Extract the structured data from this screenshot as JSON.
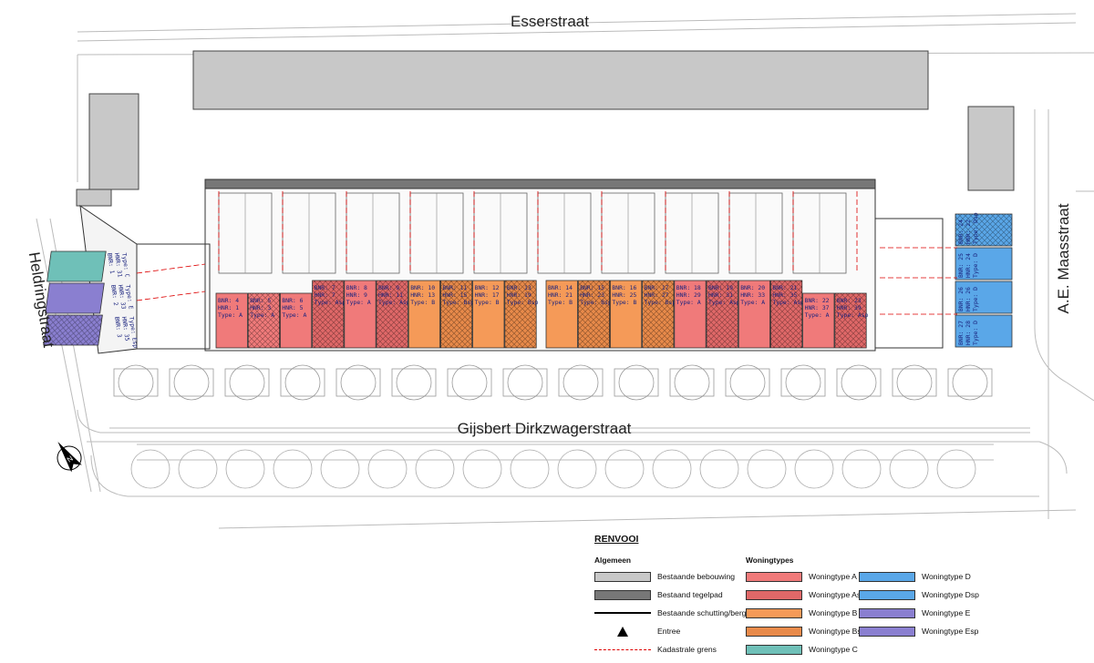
{
  "streets": {
    "north": "Esserstraat",
    "west": "Heldringstraat",
    "east": "A.E. Maasstraat",
    "south": "Gijsbert Dirkzwagerstraat"
  },
  "compass": {
    "label": "N"
  },
  "units_main": [
    {
      "bnr": "BNR: 4",
      "hnr": "HNR: 1",
      "type": "Type: A",
      "color": "#f07a7a",
      "hatch": false
    },
    {
      "bnr": "BNR: 5",
      "hnr": "HNR: 3",
      "type": "Type: A",
      "color": "#f07a7a",
      "hatch": true
    },
    {
      "bnr": "BNR: 6",
      "hnr": "HNR: 5",
      "type": "Type: A",
      "color": "#f07a7a",
      "hatch": false
    },
    {
      "bnr": "BNR: 7",
      "hnr": "HNR: 7",
      "type": "Type: Asp",
      "color": "#e06868",
      "hatch": true
    },
    {
      "bnr": "BNR: 8",
      "hnr": "HNR: 9",
      "type": "Type: A",
      "color": "#f07a7a",
      "hatch": false
    },
    {
      "bnr": "BNR: 9",
      "hnr": "HNR: 11",
      "type": "Type: Asp",
      "color": "#e06868",
      "hatch": true
    },
    {
      "bnr": "BNR: 10",
      "hnr": "HNR: 13",
      "type": "Type: B",
      "color": "#f59a58",
      "hatch": false
    },
    {
      "bnr": "BNR: 11",
      "hnr": "HNR: 15",
      "type": "Type: Bsp",
      "color": "#e88a4a",
      "hatch": true
    },
    {
      "bnr": "BNR: 12",
      "hnr": "HNR: 17",
      "type": "Type: B",
      "color": "#f59a58",
      "hatch": false
    },
    {
      "bnr": "BNR: 13",
      "hnr": "HNR: 19",
      "type": "Type: Bsp",
      "color": "#e88a4a",
      "hatch": true
    },
    {
      "bnr": "BNR: 14",
      "hnr": "HNR: 21",
      "type": "Type: B",
      "color": "#f59a58",
      "hatch": false
    },
    {
      "bnr": "BNR: 15",
      "hnr": "HNR: 23",
      "type": "Type: Bsp",
      "color": "#e88a4a",
      "hatch": true
    },
    {
      "bnr": "BNR: 16",
      "hnr": "HNR: 25",
      "type": "Type: B",
      "color": "#f59a58",
      "hatch": false
    },
    {
      "bnr": "BNR: 17",
      "hnr": "HNR: 27",
      "type": "Type: Bsp",
      "color": "#e88a4a",
      "hatch": true
    },
    {
      "bnr": "BNR: 18",
      "hnr": "HNR: 29",
      "type": "Type: A",
      "color": "#f07a7a",
      "hatch": false
    },
    {
      "bnr": "BNR: 19",
      "hnr": "HNR: 31",
      "type": "Type: Asp",
      "color": "#e06868",
      "hatch": true
    },
    {
      "bnr": "BNR: 20",
      "hnr": "HNR: 33",
      "type": "Type: A",
      "color": "#f07a7a",
      "hatch": false
    },
    {
      "bnr": "BNR: 21",
      "hnr": "HNR: 35",
      "type": "Type: Asp",
      "color": "#e06868",
      "hatch": true
    },
    {
      "bnr": "BNR: 22",
      "hnr": "HNR: 37",
      "type": "Type: A",
      "color": "#f07a7a",
      "hatch": false
    },
    {
      "bnr": "BNR: 23",
      "hnr": "HNR: 39",
      "type": "Type: Asp",
      "color": "#e06868",
      "hatch": true
    }
  ],
  "units_east": [
    {
      "bnr": "BNR: 24",
      "hnr": "HNR: 22",
      "type": "Type: Dsp",
      "color": "#5aa7e8",
      "hatch": true
    },
    {
      "bnr": "BNR: 25",
      "hnr": "HNR: 24",
      "type": "Type: D",
      "color": "#5aa7e8",
      "hatch": false
    },
    {
      "bnr": "BNR: 26",
      "hnr": "HNR: 26",
      "type": "Type: D",
      "color": "#5aa7e8",
      "hatch": false
    },
    {
      "bnr": "BNR: 27",
      "hnr": "HNR: 28",
      "type": "Type: D",
      "color": "#5aa7e8",
      "hatch": false
    }
  ],
  "units_west": [
    {
      "bnr": "BNR: 1",
      "hnr": "HNR: 31",
      "type": "Type: C",
      "color": "#6fc0b8",
      "hatch": false
    },
    {
      "bnr": "BNR: 2",
      "hnr": "HNR: 33",
      "type": "Type: E",
      "color": "#8a7fd0",
      "hatch": false
    },
    {
      "bnr": "BNR: 3",
      "hnr": "HNR: 35",
      "type": "Type: Esp",
      "color": "#8a7fd0",
      "hatch": true
    }
  ],
  "legend": {
    "title": "RENVOOI",
    "col1_head": "Algemeen",
    "col2_head": "Woningtypes",
    "general": [
      {
        "label": "Bestaande bebouwing",
        "kind": "fill",
        "color": "#c8c8c8"
      },
      {
        "label": "Bestaand tegelpad",
        "kind": "fill",
        "color": "#777777"
      },
      {
        "label": "Bestaande schutting/berging",
        "kind": "line",
        "color": "#000000"
      },
      {
        "label": "Entree",
        "kind": "triangle",
        "color": "#000000"
      },
      {
        "label": "Kadastrale grens",
        "kind": "dash",
        "color": "#dd0000"
      }
    ],
    "types_a": [
      {
        "label": "Woningtype A",
        "color": "#f07a7a",
        "hatch": false
      },
      {
        "label": "Woningtype Asp",
        "color": "#e06868",
        "hatch": true
      },
      {
        "label": "Woningtype B",
        "color": "#f59a58",
        "hatch": false
      },
      {
        "label": "Woningtype Bsp",
        "color": "#e88a4a",
        "hatch": true
      },
      {
        "label": "Woningtype C",
        "color": "#6fc0b8",
        "hatch": false
      }
    ],
    "types_b": [
      {
        "label": "Woningtype D",
        "color": "#5aa7e8",
        "hatch": false
      },
      {
        "label": "Woningtype Dsp",
        "color": "#5aa7e8",
        "hatch": true
      },
      {
        "label": "Woningtype E",
        "color": "#8a7fd0",
        "hatch": false
      },
      {
        "label": "Woningtype Esp",
        "color": "#8a7fd0",
        "hatch": true
      }
    ]
  }
}
